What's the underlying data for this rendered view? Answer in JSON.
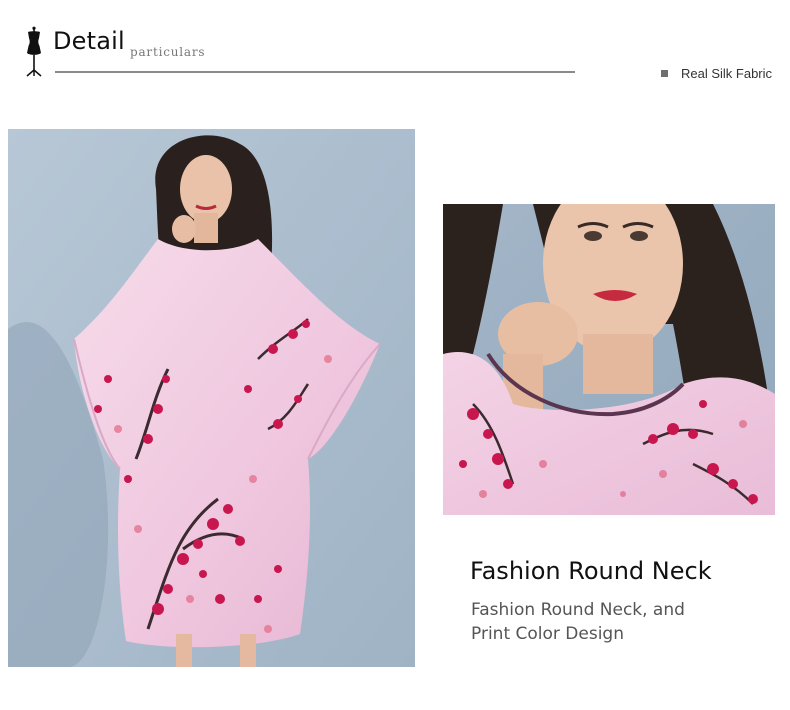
{
  "header": {
    "title": "Detail",
    "subtitle": "particulars",
    "icon": "dress-form-icon"
  },
  "tag": {
    "label": "Real Silk Fabric"
  },
  "feature": {
    "title": "Fashion Round Neck",
    "description_line1": "Fashion Round Neck, and",
    "description_line2": "Print Color Design"
  },
  "colors": {
    "background": "#ffffff",
    "heading": "#111111",
    "body_text": "#555555",
    "divider": "#8a8a8a",
    "photo_backdrop": "#a9bccd",
    "silk_pink": "#f2cfe3",
    "blossom_red": "#c8174e"
  }
}
